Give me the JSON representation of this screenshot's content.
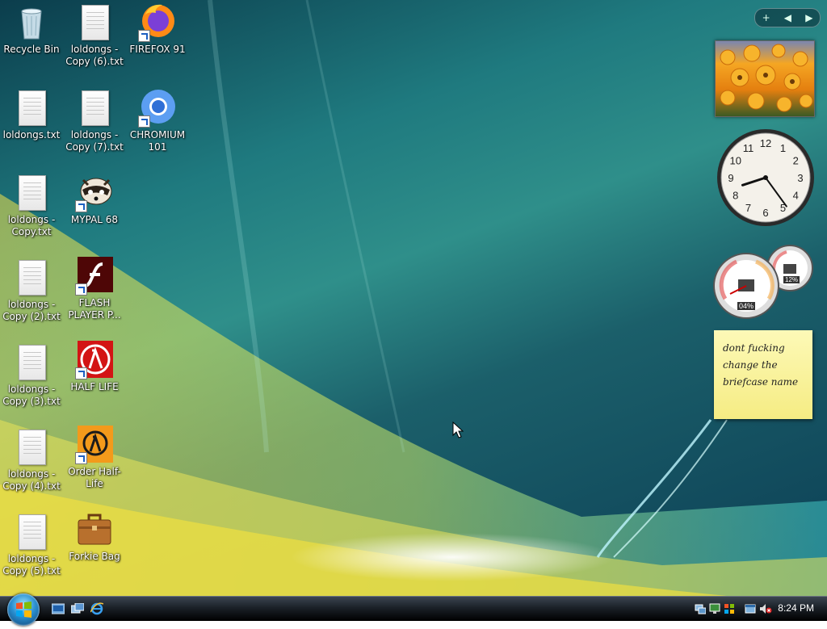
{
  "desktop": {
    "icons": [
      {
        "label": "Recycle Bin",
        "icon": "recycle-bin-icon"
      },
      {
        "label": "loldongs.txt",
        "icon": "text-file-icon"
      },
      {
        "label": "loldongs - Copy.txt",
        "icon": "text-file-icon"
      },
      {
        "label": "loldongs - Copy (2).txt",
        "icon": "text-file-icon"
      },
      {
        "label": "loldongs - Copy (3).txt",
        "icon": "text-file-icon"
      },
      {
        "label": "loldongs - Copy (4).txt",
        "icon": "text-file-icon"
      },
      {
        "label": "loldongs - Copy (5).txt",
        "icon": "text-file-icon"
      },
      {
        "label": "loldongs - Copy (6).txt",
        "icon": "text-file-icon"
      },
      {
        "label": "loldongs - Copy (7).txt",
        "icon": "text-file-icon"
      },
      {
        "label": "MYPAL 68",
        "icon": "mypal-raccoon-icon"
      },
      {
        "label": "FLASH PLAYER P...",
        "icon": "flash-player-icon"
      },
      {
        "label": "HALF LIFE",
        "icon": "half-life-icon"
      },
      {
        "label": "Order Half-Life",
        "icon": "orange-box-icon"
      },
      {
        "label": "Forkie Bag",
        "icon": "briefcase-icon"
      },
      {
        "label": "FIREFOX 91",
        "icon": "firefox-icon"
      },
      {
        "label": "CHROMIUM 101",
        "icon": "chromium-icon"
      }
    ]
  },
  "gadgets": {
    "toolbar": {
      "add": "+",
      "prev": "◀",
      "next": "▶"
    },
    "cpu": {
      "cpu_label": "04%",
      "mem_label": "12%"
    },
    "sticky_note": {
      "text": "dont fucking change the briefcase name"
    },
    "clock": {
      "hour": 8,
      "minute": 24
    }
  },
  "taskbar": {
    "clock": "8:24 PM",
    "quick_launch": [
      "show-desktop-icon",
      "switch-windows-icon",
      "internet-explorer-icon"
    ],
    "tray_icons": [
      "network-icon",
      "display-icon",
      "security-icon",
      "tray-window-icon",
      "muted-volume-icon"
    ]
  },
  "colors": {
    "accent_blue": "#1d5fc1",
    "sticky_yellow": "#fdf9b7"
  }
}
